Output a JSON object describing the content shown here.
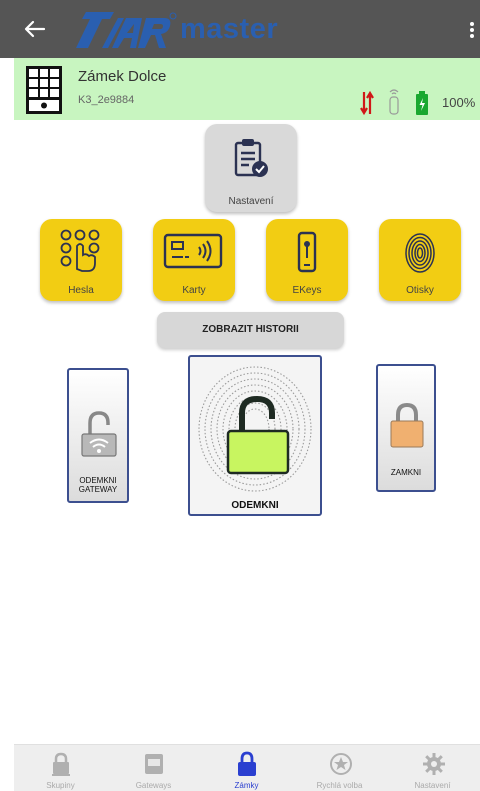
{
  "appbar": {
    "logo_text": "master",
    "logo_mark": "STAR",
    "back_icon": "arrow-left-icon",
    "menu_icon": "more-vert-icon"
  },
  "lock": {
    "name": "Zámek Dolce",
    "id": "K3_2e9884",
    "battery_percent": "100%",
    "battery_level": 1.0,
    "colors": {
      "bar": "#c8f5c0",
      "signal": "#d01818",
      "battery": "#1aa830"
    }
  },
  "settings_tile": {
    "label": "Nastavení",
    "icon": "clipboard-check-icon"
  },
  "feature_tiles": [
    {
      "label": "Hesla",
      "icon": "keypad-icon"
    },
    {
      "label": "Karty",
      "icon": "rfid-card-icon"
    },
    {
      "label": "EKeys",
      "icon": "ekey-icon"
    },
    {
      "label": "Otisky",
      "icon": "fingerprint-icon"
    }
  ],
  "history_button": "ZOBRAZIT HISTORII",
  "actions": {
    "gateway_unlock": {
      "line1": "ODEMKNI",
      "line2": "GATEWAY",
      "icon": "wifi-padlock-icon"
    },
    "unlock": {
      "label": "ODEMKNI",
      "icon": "open-padlock-icon",
      "color": "#c8f560"
    },
    "lock": {
      "label": "ZAMKNI",
      "icon": "padlock-icon",
      "color": "#f0b070"
    }
  },
  "nav": [
    {
      "label": "Skupiny",
      "icon": "groups-lock-icon"
    },
    {
      "label": "Gateways",
      "icon": "gateway-icon"
    },
    {
      "label": "Zámky",
      "icon": "lock-icon",
      "active": true
    },
    {
      "label": "Rychlá volba",
      "icon": "star-quick-icon"
    },
    {
      "label": "Nastavení",
      "icon": "gear-icon"
    }
  ],
  "theme": {
    "appbar": "#555555",
    "accent": "#2a3fd0",
    "tile_yellow": "#f2cd13"
  }
}
